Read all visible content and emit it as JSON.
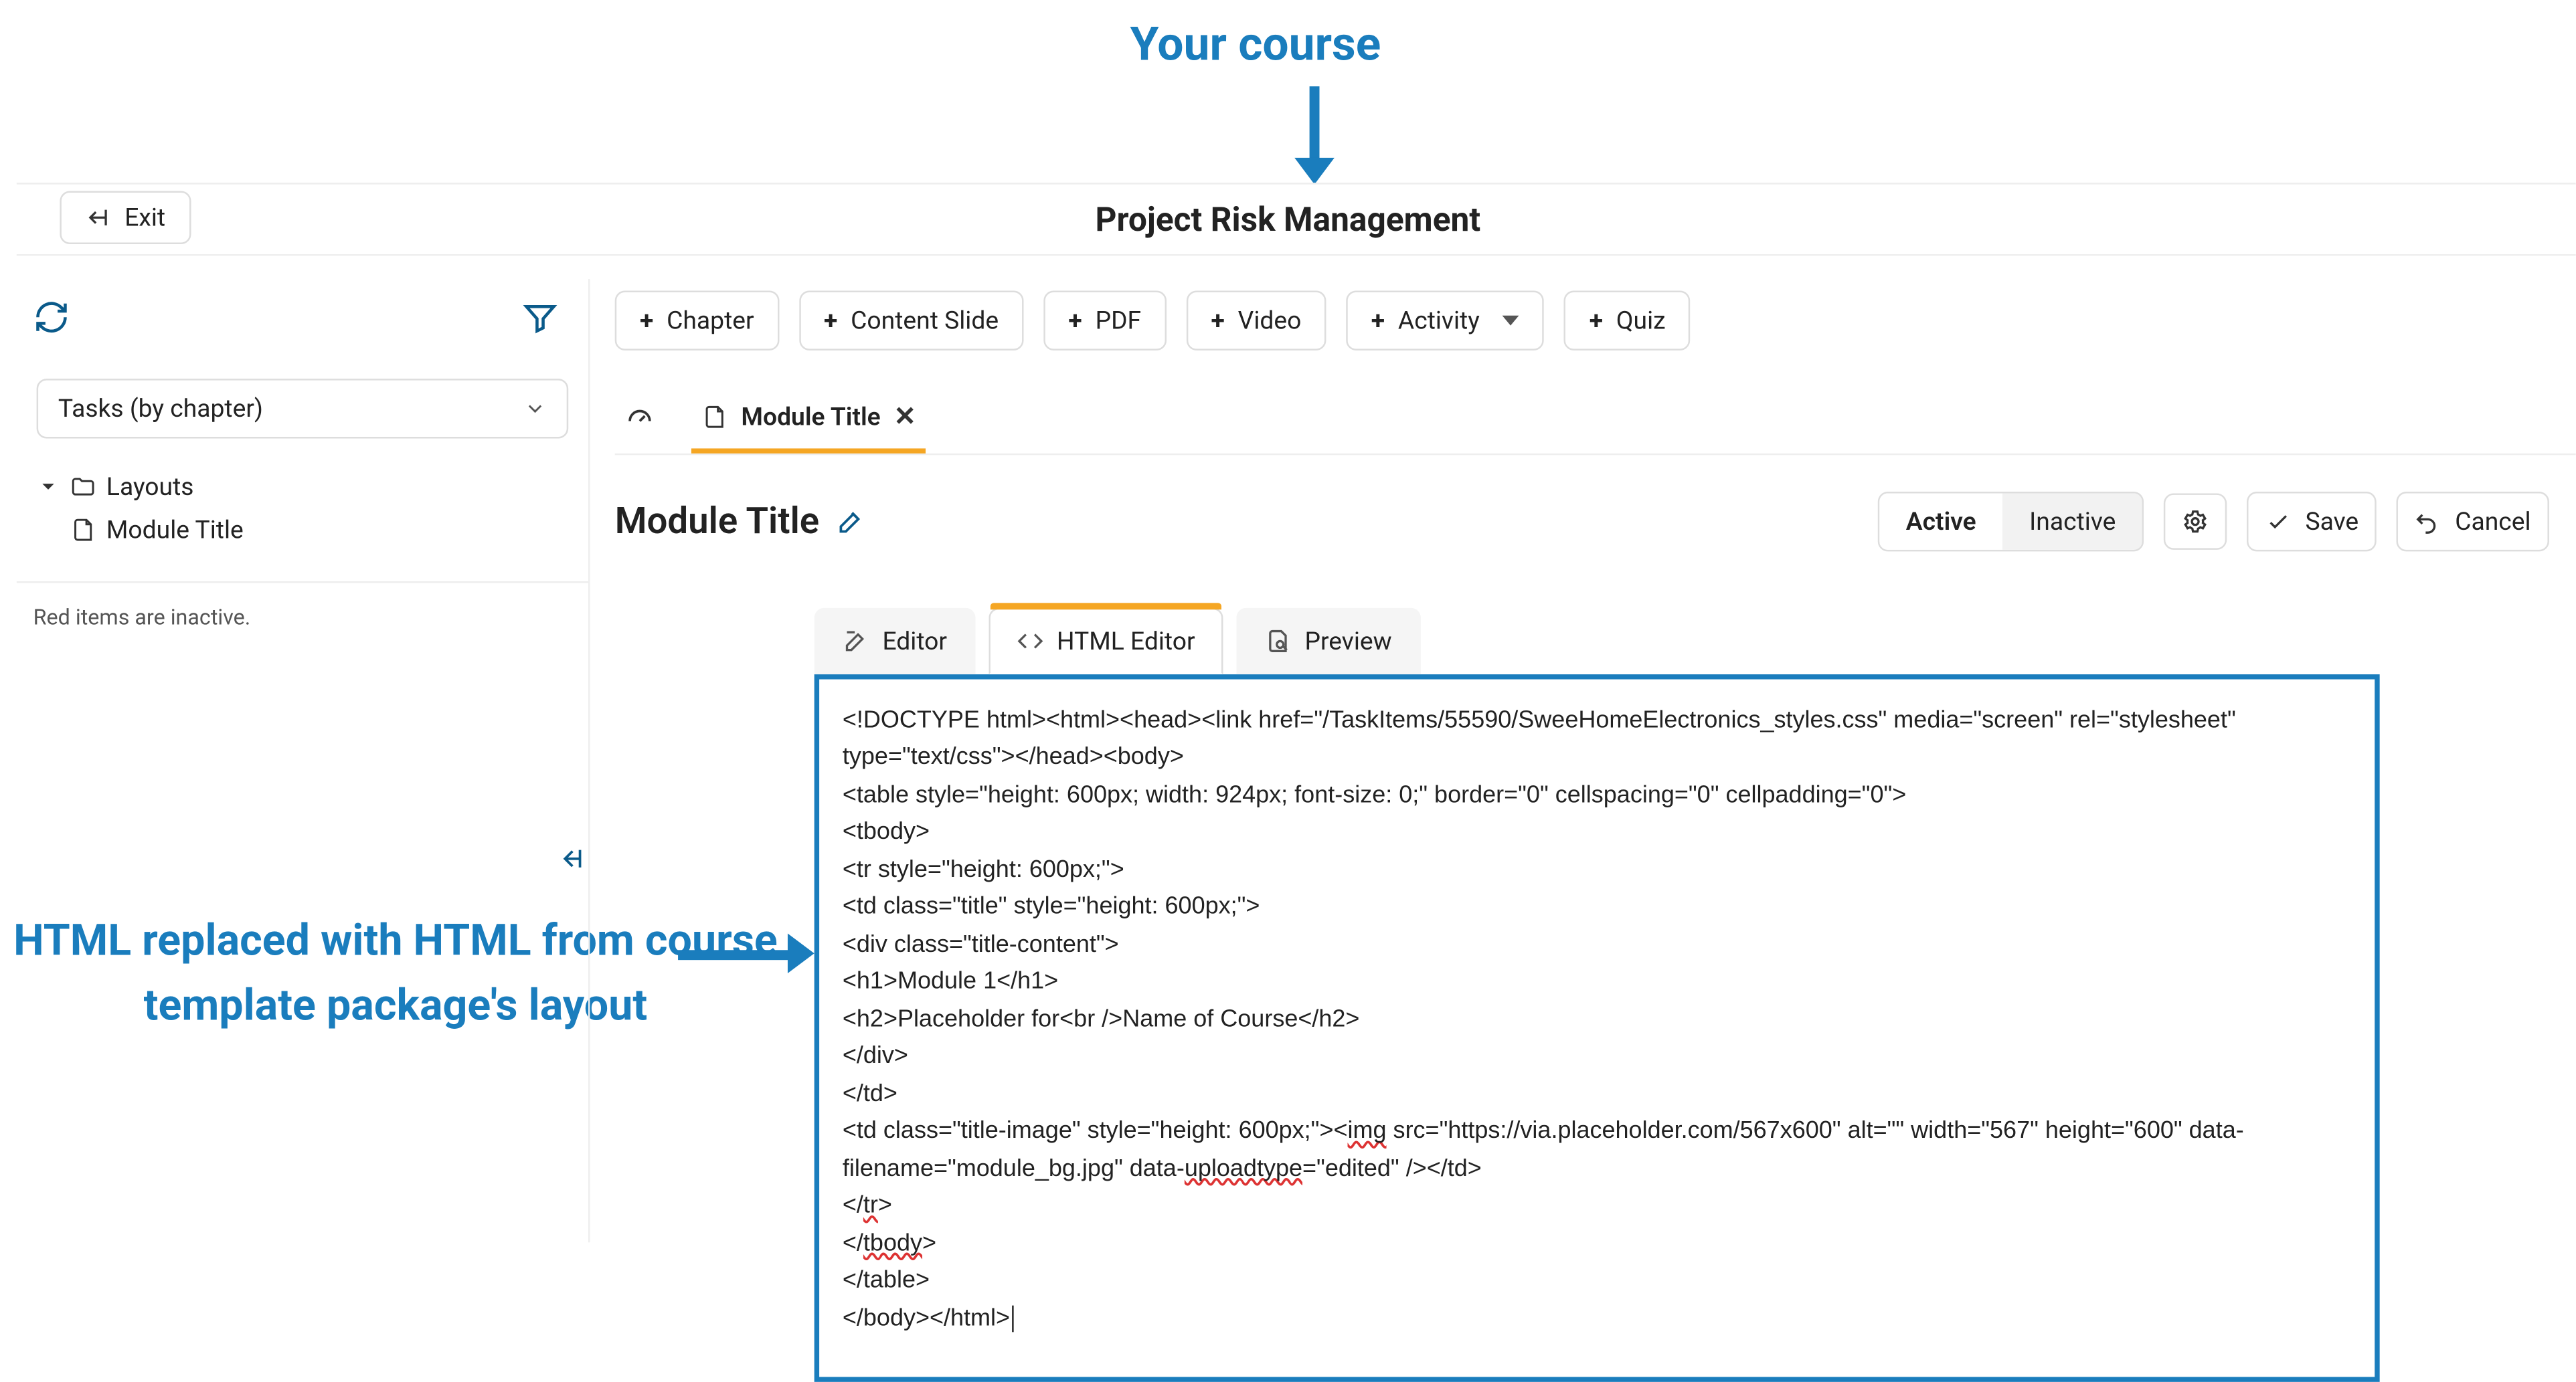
{
  "annotations": {
    "top": "Your course",
    "left": "HTML replaced with HTML from course template package's layout"
  },
  "header": {
    "exit_label": "Exit",
    "course_title": "Project Risk Management"
  },
  "sidebar": {
    "select_label": "Tasks (by chapter)",
    "tree": {
      "root_label": "Layouts",
      "child_label": "Module Title"
    },
    "inactive_note": "Red items are inactive."
  },
  "toolbar": {
    "chapter": "Chapter",
    "content_slide": "Content Slide",
    "pdf": "PDF",
    "video": "Video",
    "activity": "Activity",
    "quiz": "Quiz"
  },
  "tabs": {
    "module_title": "Module Title"
  },
  "page": {
    "title": "Module Title",
    "active": "Active",
    "inactive": "Inactive",
    "save": "Save",
    "cancel": "Cancel"
  },
  "editor_tabs": {
    "editor": "Editor",
    "html_editor": "HTML Editor",
    "preview": "Preview"
  },
  "code_lines": {
    "l1": "<!DOCTYPE html><html><head><link href=\"/TaskItems/55590/SweeHomeElectronics_styles.css\" media=\"screen\" rel=\"stylesheet\" type=\"text/css\"></head><body>",
    "l2": "<table style=\"height: 600px; width: 924px; font-size: 0;\" border=\"0\" cellspacing=\"0\" cellpadding=\"0\">",
    "l3": "<tbody>",
    "l4": "<tr style=\"height: 600px;\">",
    "l5": "<td class=\"title\" style=\"height: 600px;\">",
    "l6": "<div class=\"title-content\">",
    "l7": "<h1>Module 1</h1>",
    "l8": "<h2>Placeholder for<br />Name of Course</h2>",
    "l9": "</div>",
    "l10": "</td>",
    "l11a": "<td class=\"title-image\" style=\"height: 600px;\"><",
    "l11b": "img",
    "l11c": " src=\"https://via.placeholder.com/567x600\" alt=\"\" width=\"567\" height=\"600\" data-filename=\"module_bg.jpg\" data-",
    "l11d": "uploadtype",
    "l11e": "=\"edited\" /></td>",
    "l12a": "</",
    "l12b": "tr",
    "l12c": ">",
    "l13a": "</",
    "l13b": "tbody",
    "l13c": ">",
    "l14": "</table>",
    "l15": "</body></html>"
  }
}
